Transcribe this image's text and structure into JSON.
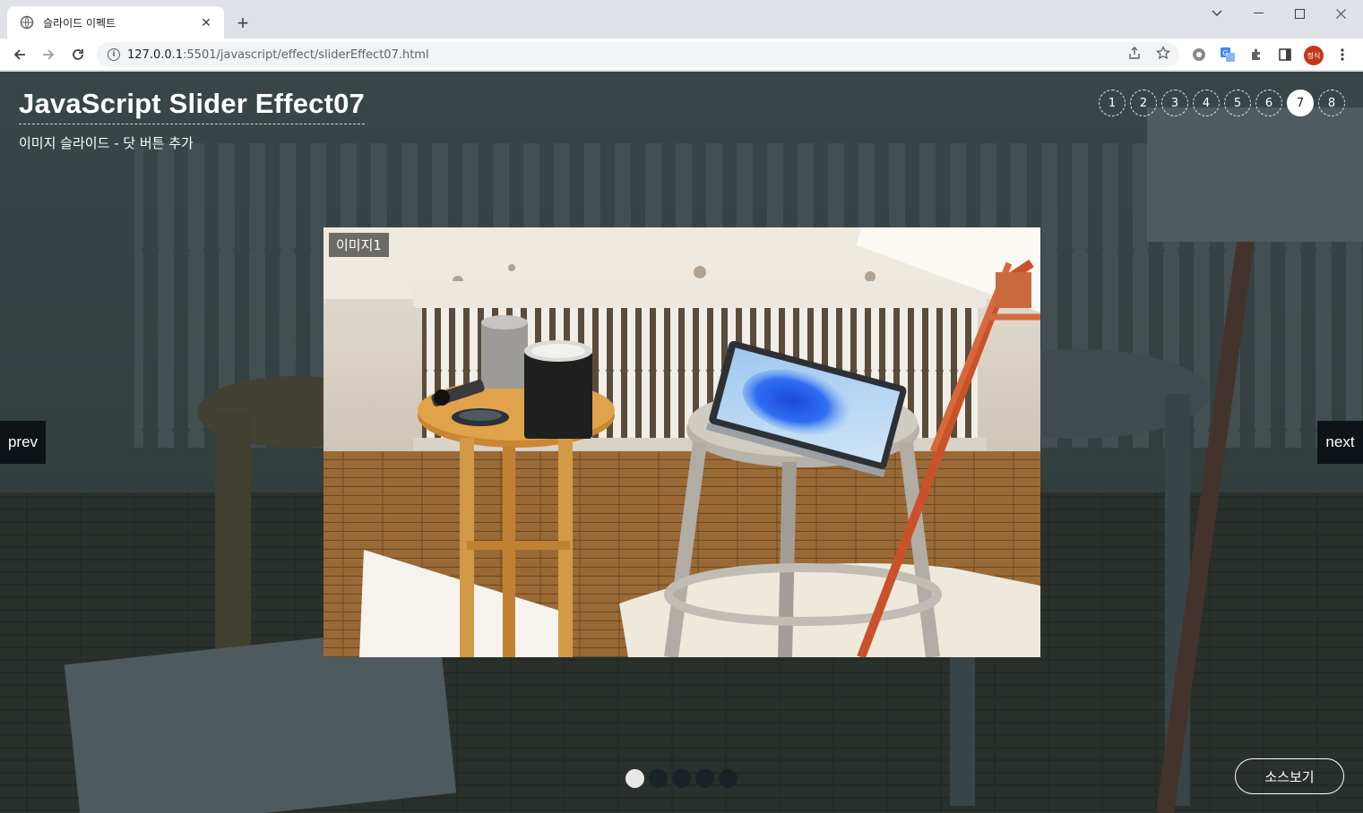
{
  "browser": {
    "tab_title": "슬라이드 이펙트",
    "url_host": "127.0.0.1",
    "url_path": ":5501/javascript/effect/sliderEffect07.html",
    "profile_label": "정식",
    "new_tab": "+",
    "tab_close": "✕"
  },
  "page": {
    "title": "JavaScript Slider Effect07",
    "subtitle": "이미지 슬라이드 - 닷 버튼 추가",
    "effect_nav": [
      "1",
      "2",
      "3",
      "4",
      "5",
      "6",
      "7",
      "8"
    ],
    "effect_nav_active": "7"
  },
  "slider": {
    "label": "이미지1",
    "prev": "prev",
    "next": "next",
    "dot_count": 5,
    "active_dot": 1
  },
  "source_button": "소스보기",
  "colors": {
    "overlay": "#12262c",
    "profile": "#c5361a",
    "active": "#ffffff"
  }
}
